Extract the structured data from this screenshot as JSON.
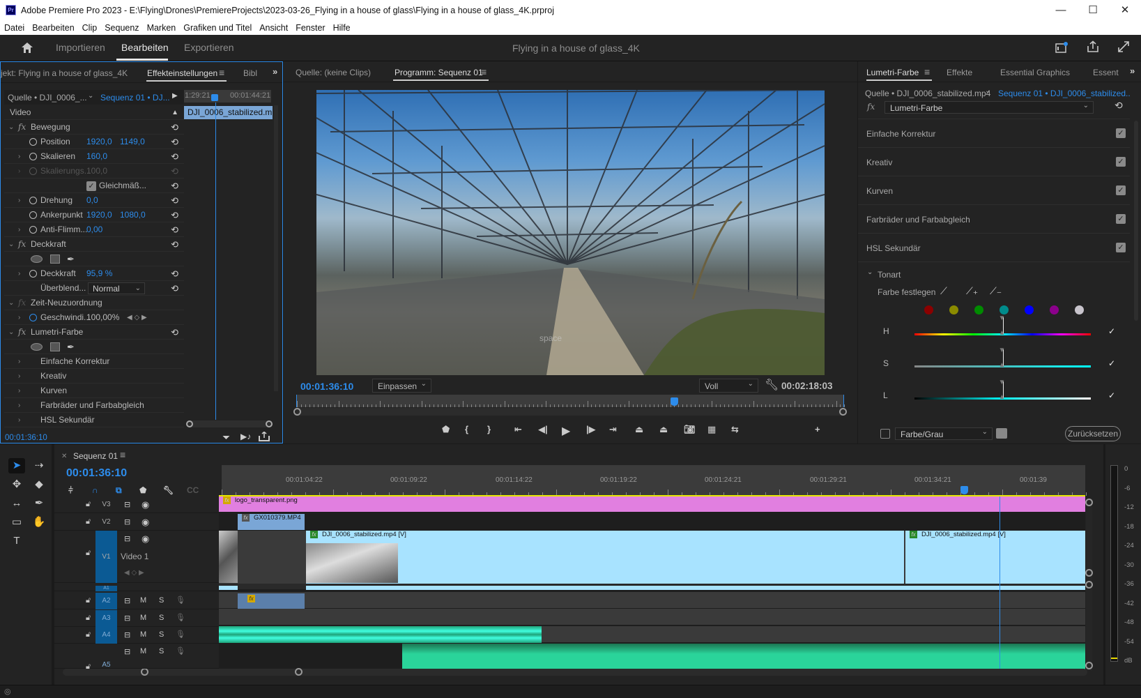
{
  "window": {
    "title": "Adobe Premiere Pro 2023 - E:\\Flying\\Drones\\PremiereProjects\\2023-03-26_Flying in a house of glass\\Flying in a house of glass_4K.prproj",
    "app_icon": "Pr",
    "minimize": "—",
    "maximize": "☐",
    "close": "✕"
  },
  "menu": [
    "Datei",
    "Bearbeiten",
    "Clip",
    "Sequenz",
    "Marken",
    "Grafiken und Titel",
    "Ansicht",
    "Fenster",
    "Hilfe"
  ],
  "header": {
    "nav": [
      "Importieren",
      "Bearbeiten",
      "Exportieren"
    ],
    "active_nav": "Bearbeiten",
    "project_title": "Flying in a house of glass_4K",
    "icons": [
      "home-icon",
      "quick-export-icon",
      "share-icon",
      "fullscreen-icon"
    ]
  },
  "effect_controls": {
    "tabs": [
      "jekt: Flying in a house of glass_4K",
      "Effekteinstellungen",
      "Bibl"
    ],
    "active_tab": "Effekteinstellungen",
    "source": "Quelle • DJI_0006_...",
    "sequence": "Sequenz 01 • DJ...",
    "timecode_start": "1:29:21",
    "timecode_end": "00:01:44:21",
    "clip_name": "DJI_0006_stabilized.mp4",
    "section": "Video",
    "rows": [
      {
        "type": "effect",
        "label": "Bewegung"
      },
      {
        "type": "param",
        "label": "Position",
        "value1": "1920,0",
        "value2": "1149,0"
      },
      {
        "type": "param",
        "label": "Skalieren",
        "value1": "160,0"
      },
      {
        "type": "param-disabled",
        "label": "Skalierungs...",
        "value1": "100,0"
      },
      {
        "type": "checkbox",
        "label": "Gleichmäß..."
      },
      {
        "type": "param",
        "label": "Drehung",
        "value1": "0,0"
      },
      {
        "type": "param",
        "label": "Ankerpunkt",
        "value1": "1920,0",
        "value2": "1080,0"
      },
      {
        "type": "param",
        "label": "Anti-Flimm...",
        "value1": "0,00"
      },
      {
        "type": "effect",
        "label": "Deckkraft"
      },
      {
        "type": "masks"
      },
      {
        "type": "param",
        "label": "Deckkraft",
        "value1": "95,9 %"
      },
      {
        "type": "select",
        "label": "Überblend...",
        "value1": "Normal"
      },
      {
        "type": "effect-disabled",
        "label": "Zeit-Neuzuordnung"
      },
      {
        "type": "speed",
        "label": "Geschwindi...",
        "value1": "100,00%"
      },
      {
        "type": "effect",
        "label": "Lumetri-Farbe"
      },
      {
        "type": "masks"
      },
      {
        "type": "sub",
        "label": "Einfache Korrektur"
      },
      {
        "type": "sub",
        "label": "Kreativ"
      },
      {
        "type": "sub",
        "label": "Kurven"
      },
      {
        "type": "sub",
        "label": "Farbräder und Farbabgleich"
      },
      {
        "type": "sub",
        "label": "HSL Sekundär"
      }
    ],
    "footer_timecode": "00:01:36:10"
  },
  "program_monitor": {
    "tabs": [
      "Quelle: (keine Clips)",
      "Programm: Sequenz 01"
    ],
    "active_tab": "Programm: Sequenz 01",
    "watermark": "space",
    "timecode": "00:01:36:10",
    "zoom_select": "Einpassen",
    "resolution_select": "Voll",
    "duration": "00:02:18:03",
    "playhead_position": 0.69,
    "controls": [
      "marker-icon",
      "mark-in-icon",
      "mark-out-icon",
      "go-to-in-icon",
      "step-back-icon",
      "play-icon",
      "step-forward-icon",
      "go-to-out-icon",
      "lift-icon",
      "extract-icon",
      "export-frame-icon",
      "comparison-view-icon",
      "proxy-toggle-icon",
      "add-button-icon"
    ]
  },
  "lumetri": {
    "tabs": [
      "Lumetri-Farbe",
      "Effekte",
      "Essential Graphics",
      "Essent"
    ],
    "active_tab": "Lumetri-Farbe",
    "source": "Quelle • DJI_0006_stabilized.mp4",
    "sequence": "Sequenz 01 • DJI_0006_stabilized...",
    "effect_select": "Lumetri-Farbe",
    "sections": [
      {
        "label": "Einfache Korrektur",
        "enabled": true
      },
      {
        "label": "Kreativ",
        "enabled": true
      },
      {
        "label": "Kurven",
        "enabled": true
      },
      {
        "label": "Farbräder und Farbabgleich",
        "enabled": true
      },
      {
        "label": "HSL Sekundär",
        "enabled": true
      }
    ],
    "subsection": "Tonart",
    "set_color_label": "Farbe festlegen",
    "swatches": [
      "#8b0000",
      "#8b8b00",
      "#008b00",
      "#008b8b",
      "#0000ff",
      "#8b008b",
      "#c8c4cc"
    ],
    "sliders": [
      {
        "label": "H",
        "value": 0.5,
        "checked": true
      },
      {
        "label": "S",
        "value": 0.5,
        "checked": true
      },
      {
        "label": "L",
        "value": 0.5,
        "checked": true
      }
    ],
    "color_gray_checkbox": false,
    "color_gray_select": "Farbe/Grau",
    "reset_button": "Zurücksetzen"
  },
  "timeline": {
    "tab": "Sequenz 01",
    "timecode": "00:01:36:10",
    "ruler": [
      "00:01:04:22",
      "00:01:09:22",
      "00:01:14:22",
      "00:01:19:22",
      "00:01:24:21",
      "00:01:29:21",
      "00:01:34:21",
      "00:01:39"
    ],
    "video_tracks": [
      {
        "id": "V3",
        "name": ""
      },
      {
        "id": "V2",
        "name": ""
      },
      {
        "id": "V1",
        "name": "Video 1"
      }
    ],
    "audio_tracks": [
      {
        "id": "A1"
      },
      {
        "id": "A2"
      },
      {
        "id": "A3"
      },
      {
        "id": "A4"
      },
      {
        "id": "A5"
      }
    ],
    "track_buttons": {
      "mute": "M",
      "solo": "S"
    },
    "clips": {
      "v3": "logo_transparent.png",
      "v2": "GX010379.MP4",
      "v1a": "DJI_0006_stabilized.mp4 [V]",
      "v1b": "DJI_0006_stabilized.mp4 [V]"
    },
    "tools": [
      "selection-tool",
      "track-select-tool",
      "ripple-edit-tool",
      "razor-tool",
      "slip-tool",
      "pen-tool",
      "rectangle-tool",
      "hand-tool",
      "type-tool"
    ]
  },
  "audio_meter": {
    "labels": [
      "0",
      "-6",
      "-12",
      "-18",
      "-24",
      "-30",
      "-36",
      "-42",
      "-48",
      "-54",
      "dB"
    ]
  }
}
